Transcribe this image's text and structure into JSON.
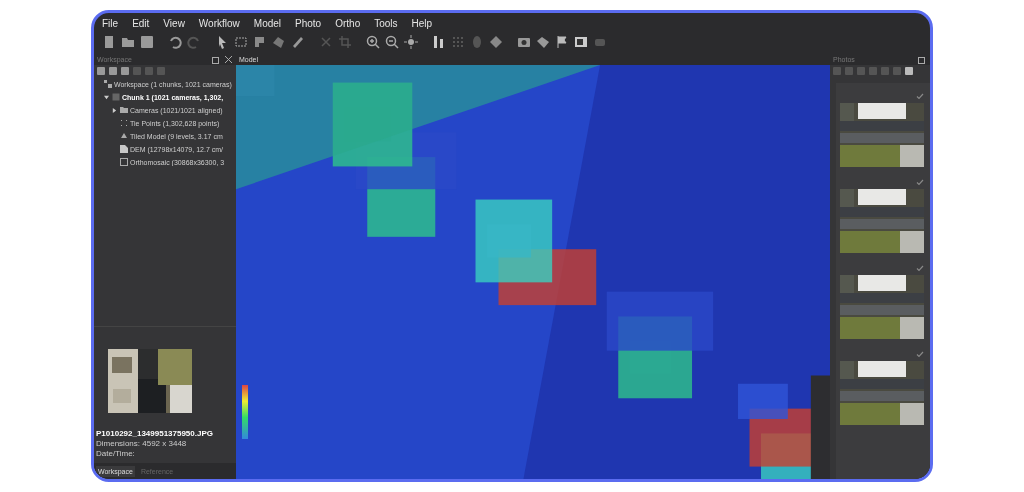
{
  "menu": [
    "File",
    "Edit",
    "View",
    "Workflow",
    "Model",
    "Photo",
    "Ortho",
    "Tools",
    "Help"
  ],
  "workspace": {
    "title": "Workspace",
    "tree": [
      {
        "label": "Workspace (1 chunks, 1021 cameras)",
        "kind": "workspace",
        "children": [
          {
            "label": "Chunk 1 (1021 cameras, 1,302,",
            "kind": "chunk",
            "expanded": true,
            "children": [
              {
                "label": "Cameras (1021/1021 aligned)",
                "kind": "cameras",
                "expanded": false
              },
              {
                "label": "Tie Points (1,302,628 points)",
                "kind": "points"
              },
              {
                "label": "Tiled Model (9 levels, 3.17 cm",
                "kind": "model"
              },
              {
                "label": "DEM (12798x14079, 12.7 cm/",
                "kind": "dem"
              },
              {
                "label": "Orthomosaic (30868x36300, 3",
                "kind": "ortho"
              }
            ]
          }
        ]
      }
    ],
    "photo": {
      "filename": "P1010292_1349951375950.JPG",
      "dimensions": "Dimensions: 4592 x 3448",
      "datetime": "Date/Time:"
    },
    "tabs": [
      {
        "label": "Workspace",
        "selected": true
      },
      {
        "label": "Reference",
        "selected": false
      }
    ]
  },
  "model": {
    "title": "Model"
  },
  "photos": {
    "title": "Photos",
    "items": [
      {
        "checked": true
      },
      {
        "checked": true
      },
      {
        "checked": true
      },
      {
        "checked": true
      }
    ]
  }
}
